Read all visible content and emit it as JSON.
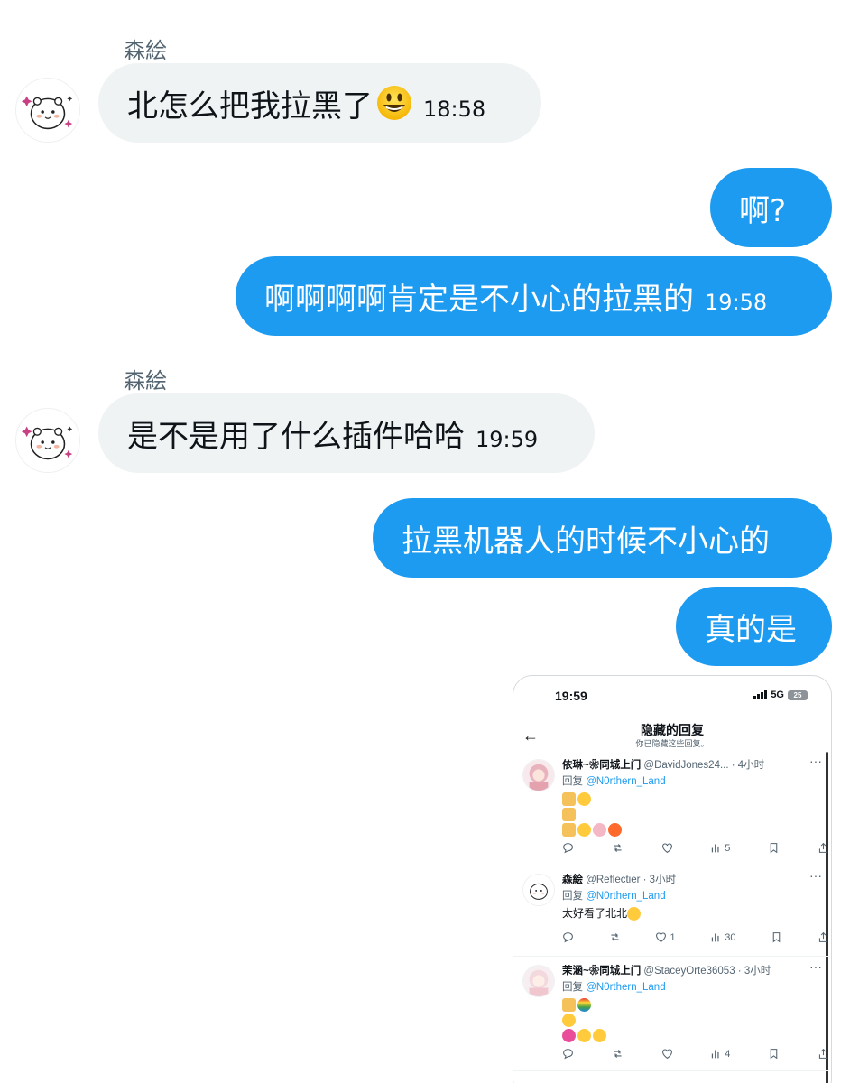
{
  "messages": [
    {
      "sender": "森絵",
      "text": "北怎么把我拉黑了",
      "emoji": "grinning-face-emoji",
      "time": "18:58"
    },
    {
      "text": "啊?"
    },
    {
      "text": "啊啊啊啊肯定是不小心的拉黑的",
      "time": "19:58"
    },
    {
      "sender": "森絵",
      "text": "是不是用了什么插件哈哈",
      "time": "19:59"
    },
    {
      "text": "拉黑机器人的时候不小心的"
    },
    {
      "text": "真的是"
    }
  ],
  "screenshot": {
    "status_time": "19:59",
    "network": "5G",
    "battery": "25",
    "title": "隐藏的回复",
    "subtitle": "你已隐藏这些回复。",
    "replies": [
      {
        "name": "依琳~❀同城上门",
        "handle": "@DavidJones24... · 4小时",
        "reply_label": "回复",
        "reply_to": "@N0rthern_Land",
        "views": "5"
      },
      {
        "name": "森絵",
        "handle": "@Reflectier · 3小时",
        "reply_label": "回复",
        "reply_to": "@N0rthern_Land",
        "text": "太好看了北北",
        "likes": "1",
        "views": "30"
      },
      {
        "name": "茉涵~❀同城上门",
        "handle": "@StaceyOrte36053 · 3小时",
        "reply_label": "回复",
        "reply_to": "@N0rthern_Land",
        "views": "4"
      }
    ]
  }
}
